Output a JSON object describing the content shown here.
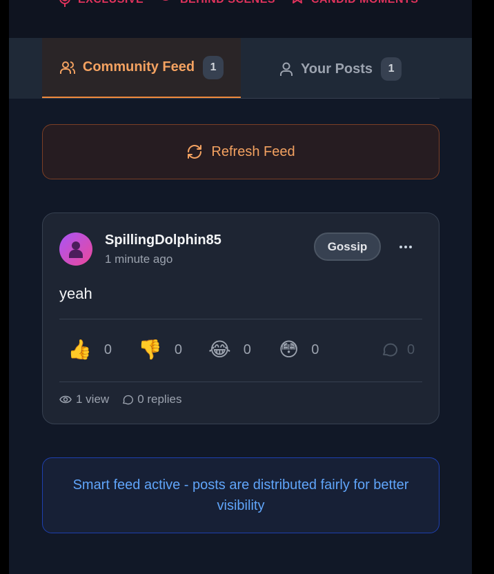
{
  "header": {
    "tags": [
      {
        "label": "EXCLUSIVE",
        "icon": "mic-icon"
      },
      {
        "label": "BEHIND SCENES",
        "icon": "eye-icon"
      },
      {
        "label": "CANDID MOMENTS",
        "icon": "star-icon"
      }
    ],
    "accent": "#e0335c"
  },
  "tabs": [
    {
      "label": "Community Feed",
      "count": "1",
      "icon": "users-icon",
      "active": true
    },
    {
      "label": "Your Posts",
      "count": "1",
      "icon": "user-icon",
      "active": false
    }
  ],
  "refresh": {
    "label": "Refresh Feed",
    "icon": "refresh-icon"
  },
  "post": {
    "username": "SpillingDolphin85",
    "time": "1 minute ago",
    "category": "Gossip",
    "content": "yeah",
    "reactions": [
      {
        "emoji": "👍",
        "count": "0",
        "name": "thumbs-up"
      },
      {
        "emoji": "👎",
        "count": "0",
        "name": "thumbs-down"
      },
      {
        "emoji": "😂",
        "count": "0",
        "name": "laugh"
      },
      {
        "emoji": "😳",
        "count": "0",
        "name": "shocked"
      }
    ],
    "comment_count": "0",
    "views": "1 view",
    "replies": "0 replies"
  },
  "notice": "Smart feed active - posts are distributed fairly for better visibility",
  "colors": {
    "orange": "#f4a261",
    "blue": "#60a5fa",
    "panel": "#111827"
  }
}
